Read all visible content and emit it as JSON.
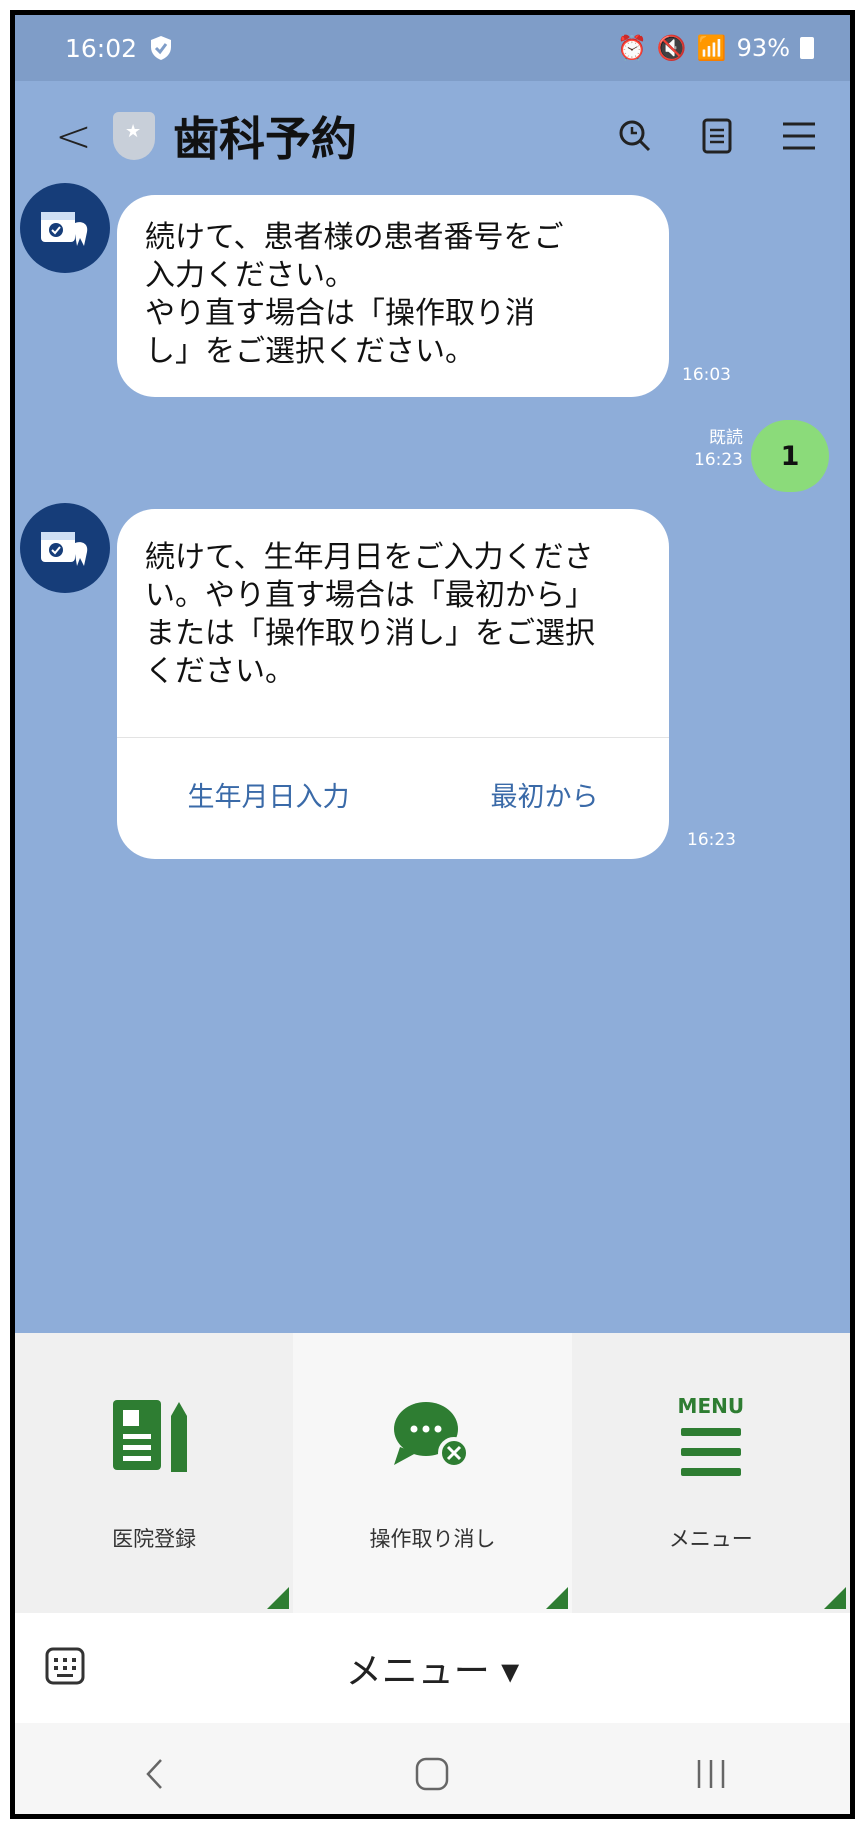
{
  "status_bar": {
    "time": "16:02",
    "battery": "93%"
  },
  "header": {
    "title": "歯科予約"
  },
  "messages": [
    {
      "text": "続けて、患者様の患者番号をご\n入力ください。\nやり直す場合は「操作取り消\nし」をご選択ください。",
      "time": "16:03"
    },
    {
      "sent_text": "1",
      "read": "既読",
      "time": "16:23"
    },
    {
      "text": "続けて、生年月日をご入力くださ\nい。やり直す場合は「最初から」\nまたは「操作取り消し」をご選択\nください。",
      "time": "16:23",
      "buttons": [
        "生年月日入力",
        "最初から"
      ]
    }
  ],
  "rich_menu": {
    "items": [
      {
        "label": "医院登録",
        "icon": "clinic-register-icon"
      },
      {
        "label": "操作取り消し",
        "icon": "cancel-chat-icon"
      },
      {
        "label": "メニュー",
        "icon": "menu-icon",
        "icon_text": "MENU"
      }
    ]
  },
  "menu_bar": {
    "label": "メニュー ▾"
  },
  "colors": {
    "chat_bg": "#8eadd9",
    "accent_green": "#2e7d32",
    "sent_bubble": "#8bdb7a",
    "link_blue": "#3a6aa8"
  }
}
